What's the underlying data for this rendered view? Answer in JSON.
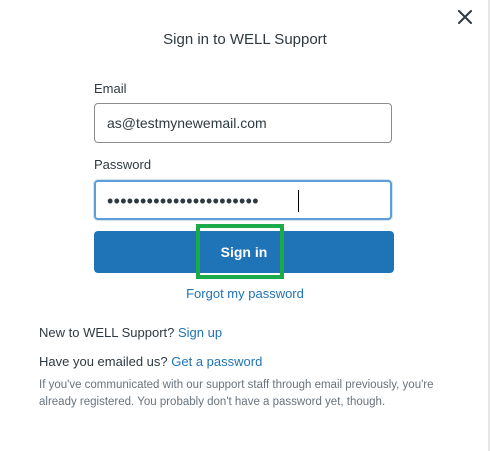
{
  "dialog": {
    "title": "Sign in to WELL Support",
    "close_icon": "close-icon"
  },
  "form": {
    "email_label": "Email",
    "email_value": "as@testmynewemail.com",
    "password_label": "Password",
    "password_masked": "•••••••••••••••••••••••",
    "sign_in_label": "Sign in",
    "forgot_label": "Forgot my password"
  },
  "footer": {
    "new_prefix": "New to WELL Support?",
    "new_link": "Sign up",
    "emailed_prefix": "Have you emailed us?",
    "emailed_link": "Get a password",
    "note": "If you've communicated with our support staff through email previously, you're already registered. You probably don't have a password yet, though."
  },
  "colors": {
    "primary": "#1f73b7",
    "highlight": "#1aaa4a",
    "focus_ring": "#5b9fd6"
  }
}
